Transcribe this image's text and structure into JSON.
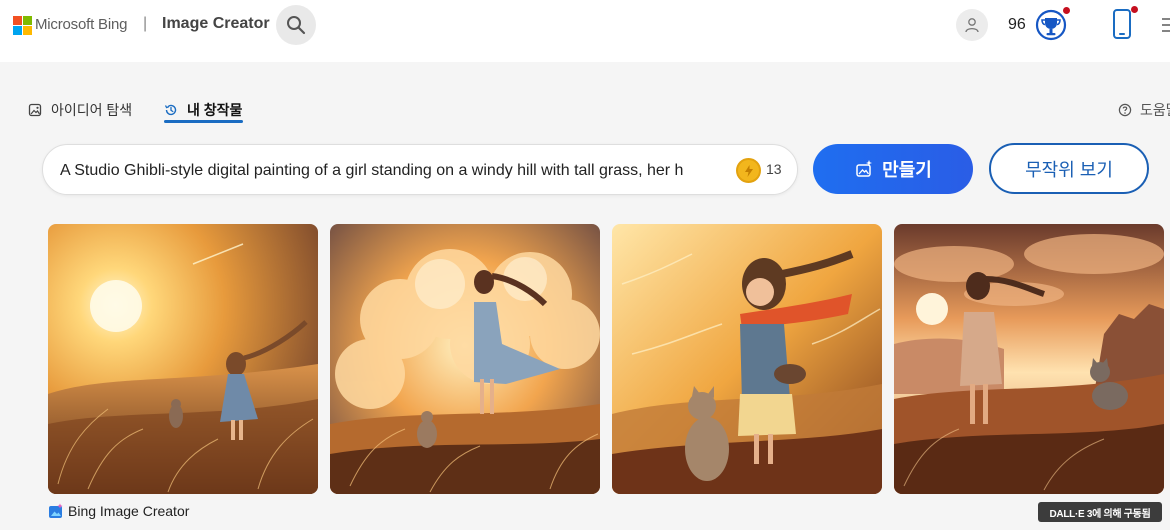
{
  "header": {
    "brand": "Microsoft Bing",
    "separator": "|",
    "product": "Image Creator",
    "points": "96",
    "icons": {
      "logo": "microsoft-logo",
      "search": "search-icon",
      "user": "user-icon",
      "rewards": "trophy-icon",
      "phone": "phone-icon",
      "menu": "grid-menu-icon"
    }
  },
  "tabs": [
    {
      "label": "아이디어 탐색",
      "icon": "image-icon",
      "active": false
    },
    {
      "label": "내 창작물",
      "icon": "history-icon",
      "active": true
    }
  ],
  "help": {
    "label": "도움말",
    "icon": "help-icon"
  },
  "prompt": {
    "value": "A Studio Ghibli-style digital painting of a girl standing on a windy hill with tall grass, her h",
    "boosts": "13",
    "boost_icon": "coin-icon"
  },
  "buttons": {
    "create": "만들기",
    "surprise": "무작위 보기"
  },
  "results": [
    {
      "name": "generated-image-1"
    },
    {
      "name": "generated-image-2"
    },
    {
      "name": "generated-image-3"
    },
    {
      "name": "generated-image-4"
    }
  ],
  "footer": {
    "brand": "Bing Image Creator",
    "badge": "DALL·E 3에 의해 구동됨"
  },
  "colors": {
    "accent": "#1f6ef0",
    "accent_dark": "#1a5fb4",
    "ms_red": "#f25022",
    "ms_green": "#7fba00",
    "ms_blue": "#00a4ef",
    "ms_yellow": "#ffb900",
    "coin": "#f2b61d",
    "notification": "#c50f1f"
  }
}
